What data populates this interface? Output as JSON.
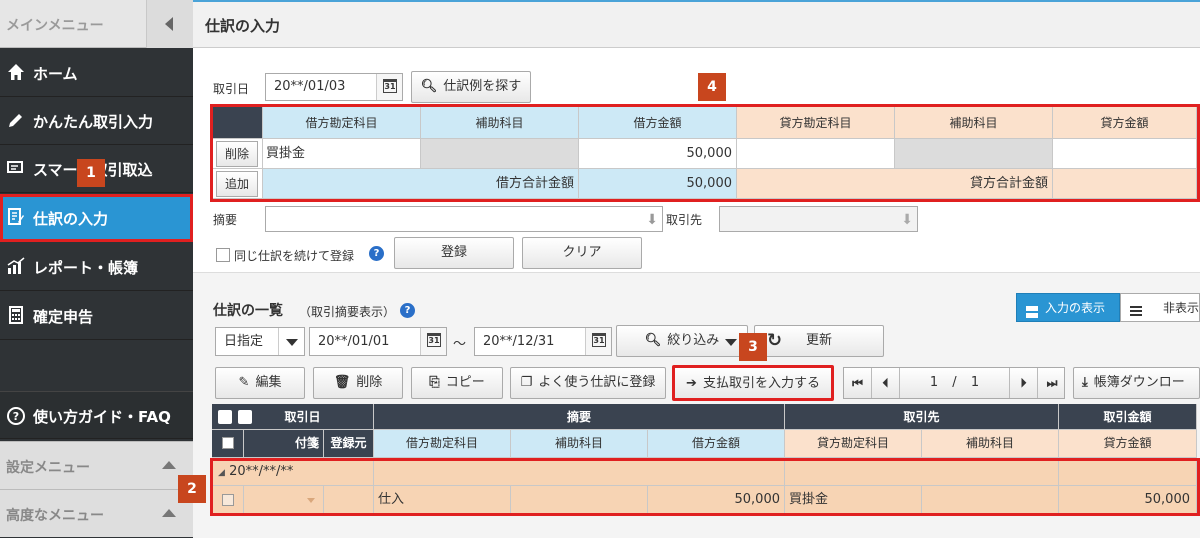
{
  "sidebar": {
    "title": "メインメニュー",
    "items": [
      {
        "label": "ホーム"
      },
      {
        "label": "かんたん取引入力"
      },
      {
        "label": "スマート取引取込"
      },
      {
        "label": "仕訳の入力"
      },
      {
        "label": "レポート・帳簿"
      },
      {
        "label": "確定申告"
      }
    ],
    "guide_label": "使い方ガイド・FAQ",
    "settings_label": "設定メニュー",
    "advanced_label": "高度なメニュー"
  },
  "badges": {
    "b1": "1",
    "b2": "2",
    "b3": "3",
    "b4": "4"
  },
  "header": {
    "title": "仕訳の入力"
  },
  "entry": {
    "date_label": "取引日",
    "date_value": "20**/01/03",
    "find_example_label": "仕訳例を探す",
    "columns": {
      "debit_account": "借方勘定科目",
      "debit_sub": "補助科目",
      "debit_amount": "借方金額",
      "credit_account": "貸方勘定科目",
      "credit_sub": "補助科目",
      "credit_amount": "貸方金額"
    },
    "delete_label": "削除",
    "add_label": "追加",
    "row1": {
      "debit_account": "買掛金",
      "debit_amount": "50,000"
    },
    "debit_total_label": "借方合計金額",
    "debit_total": "50,000",
    "credit_total_label": "貸方合計金額",
    "memo_label": "摘要",
    "partner_label": "取引先",
    "continue_label": "同じ仕訳を続けて登録",
    "register_label": "登録",
    "clear_label": "クリア"
  },
  "list": {
    "title": "仕訳の一覧",
    "subtitle": "（取引摘要表示）",
    "toggle_on": "入力の表示",
    "toggle_off": "非表示",
    "date_mode": "日指定",
    "from_date": "20**/01/01",
    "tilde": "～",
    "to_date": "20**/12/31",
    "filter_label": "絞り込み",
    "refresh_label": "更新",
    "edit_label": "編集",
    "delete_label": "削除",
    "copy_label": "コピー",
    "favorite_label": "よく使う仕訳に登録",
    "payment_label": "支払取引を入力する",
    "page_current": "1",
    "page_sep": "/",
    "page_total": "1",
    "download_label": "帳簿ダウンロー",
    "headers": {
      "date": "取引日",
      "memo": "摘要",
      "partner": "取引先",
      "amount": "取引金額",
      "attach": "付箋",
      "source": "登録元",
      "debit_account": "借方勘定科目",
      "debit_sub": "補助科目",
      "debit_amount": "借方金額",
      "credit_account": "貸方勘定科目",
      "credit_sub": "補助科目",
      "credit_amount": "貸方金額"
    },
    "group_date": "20**/**/**",
    "row": {
      "memo": "仕入",
      "debit_amount": "50,000",
      "credit_account": "買掛金",
      "credit_amount": "50,000"
    }
  }
}
